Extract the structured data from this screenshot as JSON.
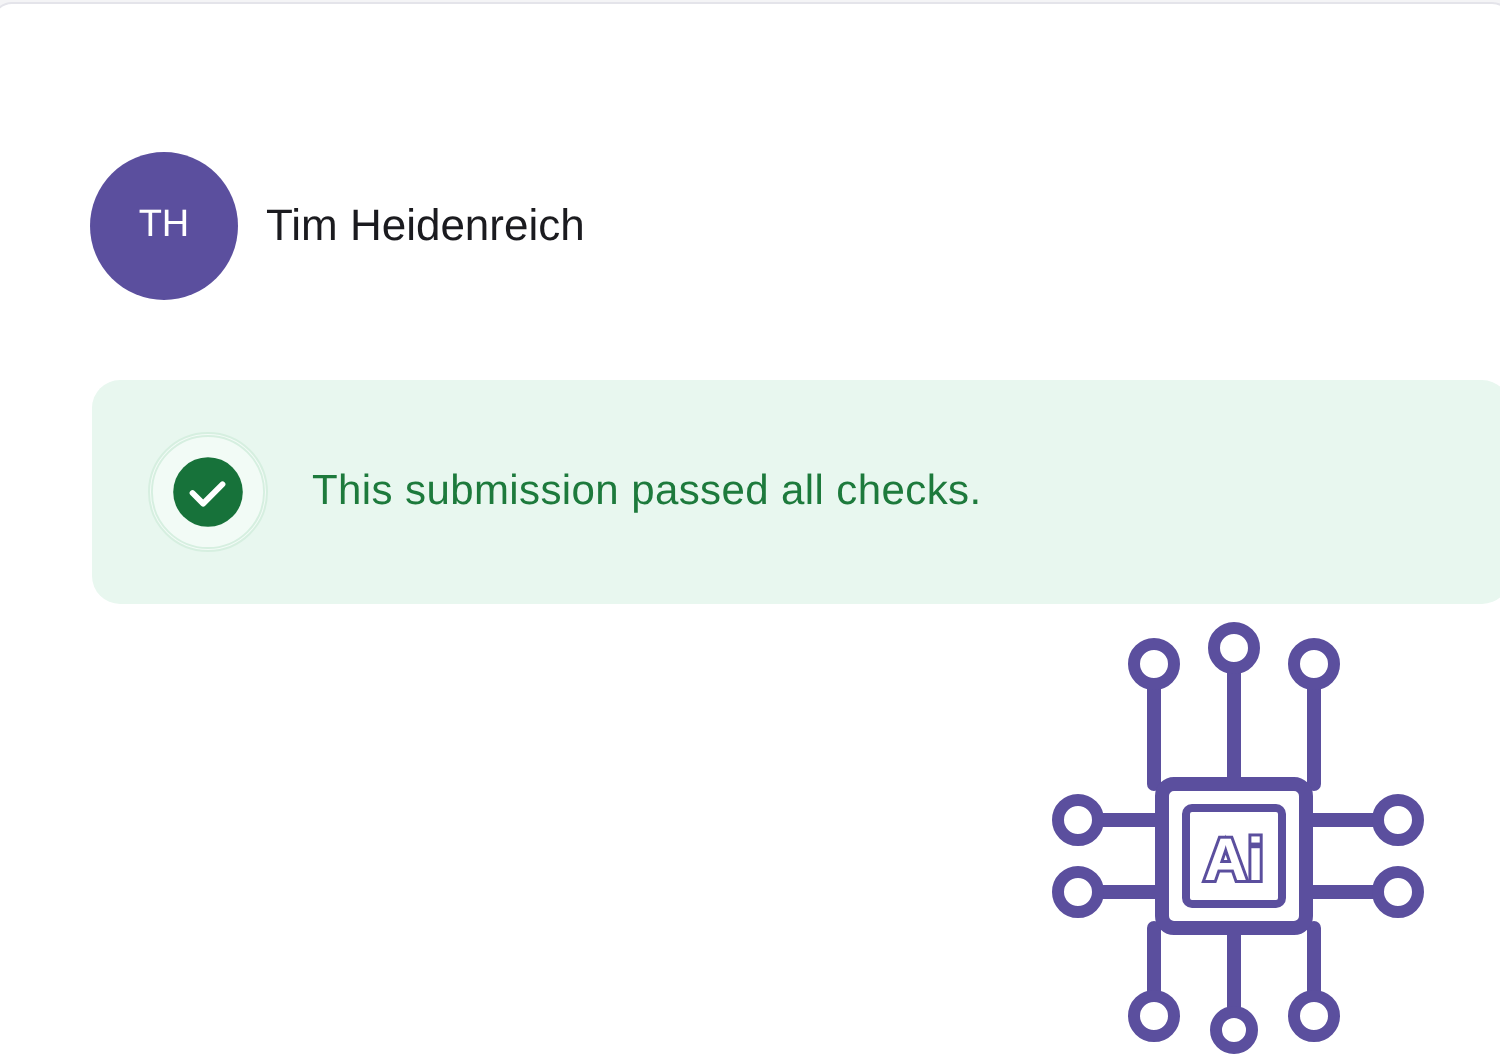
{
  "author": {
    "initials": "TH",
    "name": "Tim Heidenreich"
  },
  "status": {
    "kind": "success",
    "message": "This submission passed all checks."
  },
  "sticker": {
    "label": "Ai"
  }
}
